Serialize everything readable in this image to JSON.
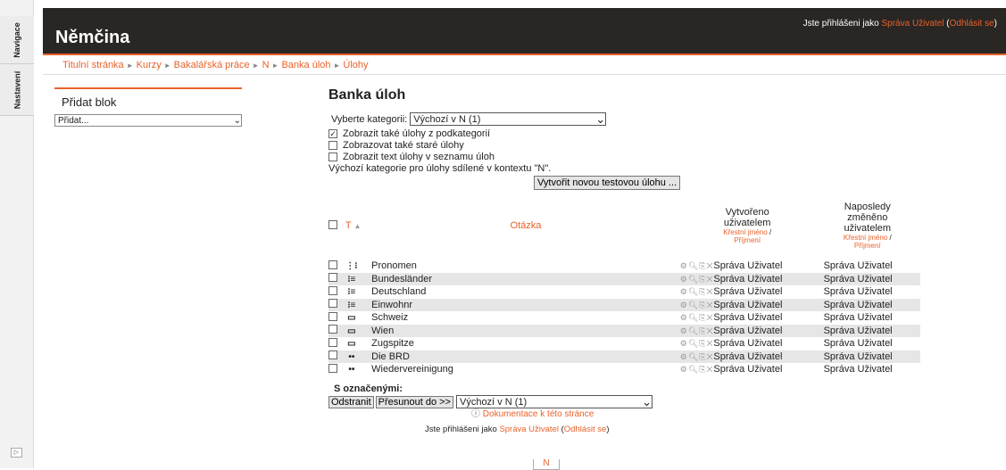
{
  "dock": {
    "tabs": [
      "Navigace",
      "Nastavení"
    ],
    "expand_icon": "expand-icon"
  },
  "header": {
    "title": "Němčina",
    "login_prefix": "Jste přihlášeni jako ",
    "user": "Správa Uživatel",
    "logout_open": " (",
    "logout": "Odhlásit se",
    "logout_close": ")"
  },
  "breadcrumb": [
    "Titulní stránka",
    "Kurzy",
    "Bakalářská práce",
    "N",
    "Banka úloh",
    "Úlohy"
  ],
  "block": {
    "title": "Přidat blok",
    "select_value": "Přidat..."
  },
  "main": {
    "heading": "Banka úloh",
    "category_label": "Vyberte kategorii:",
    "category_value": "Výchozí v N (1)",
    "options": [
      {
        "label": "Zobrazit také úlohy z podkategorií",
        "checked": true
      },
      {
        "label": "Zobrazovat také staré úlohy",
        "checked": false
      },
      {
        "label": "Zobrazit text úlohy v seznamu úloh",
        "checked": false
      }
    ],
    "shared_note": "Výchozí kategorie pro úlohy sdílené v kontextu \"N\".",
    "create_button": "Vytvořit novou testovou úlohu ..."
  },
  "table": {
    "col_type": "T",
    "col_question": "Otázka",
    "col_created": [
      "Vytvořeno",
      "uživatelem"
    ],
    "col_modified": [
      "Naposledy",
      "změněno",
      "uživatelem"
    ],
    "sort_first": "Křestní jméno",
    "sort_sep": " / ",
    "sort_last": "Příjmení",
    "rows": [
      {
        "name": "Pronomen",
        "icon": "⋮⁝",
        "created": "Správa Uživatel",
        "modified": "Správa Uživatel"
      },
      {
        "name": "Bundesländer",
        "icon": "⁝≡",
        "created": "Správa Uživatel",
        "modified": "Správa Uživatel"
      },
      {
        "name": "Deutschland",
        "icon": "⁝≡",
        "created": "Správa Uživatel",
        "modified": "Správa Uživatel"
      },
      {
        "name": "Einwohnr",
        "icon": "⁝≡",
        "created": "Správa Uživatel",
        "modified": "Správa Uživatel"
      },
      {
        "name": "Schweiz",
        "icon": "▭",
        "created": "Správa Uživatel",
        "modified": "Správa Uživatel"
      },
      {
        "name": "Wien",
        "icon": "▭",
        "created": "Správa Uživatel",
        "modified": "Správa Uživatel"
      },
      {
        "name": "Zugspitze",
        "icon": "▭",
        "created": "Správa Uživatel",
        "modified": "Správa Uživatel"
      },
      {
        "name": "Die BRD",
        "icon": "••",
        "created": "Správa Uživatel",
        "modified": "Správa Uživatel"
      },
      {
        "name": "Wiedervereinigung",
        "icon": "••",
        "created": "Správa Uživatel",
        "modified": "Správa Uživatel"
      }
    ]
  },
  "bulk": {
    "label": "S označenými:",
    "delete": "Odstranit",
    "move": "Přesunout do >>",
    "target": "Výchozí v N (1)"
  },
  "docs_link": "Dokumentace k této stránce",
  "footer": {
    "prefix": "Jste přihlášeni jako ",
    "user": "Správa Uživatel",
    "open": " (",
    "logout": "Odhlásit se",
    "close": ")",
    "course_button": "N"
  }
}
